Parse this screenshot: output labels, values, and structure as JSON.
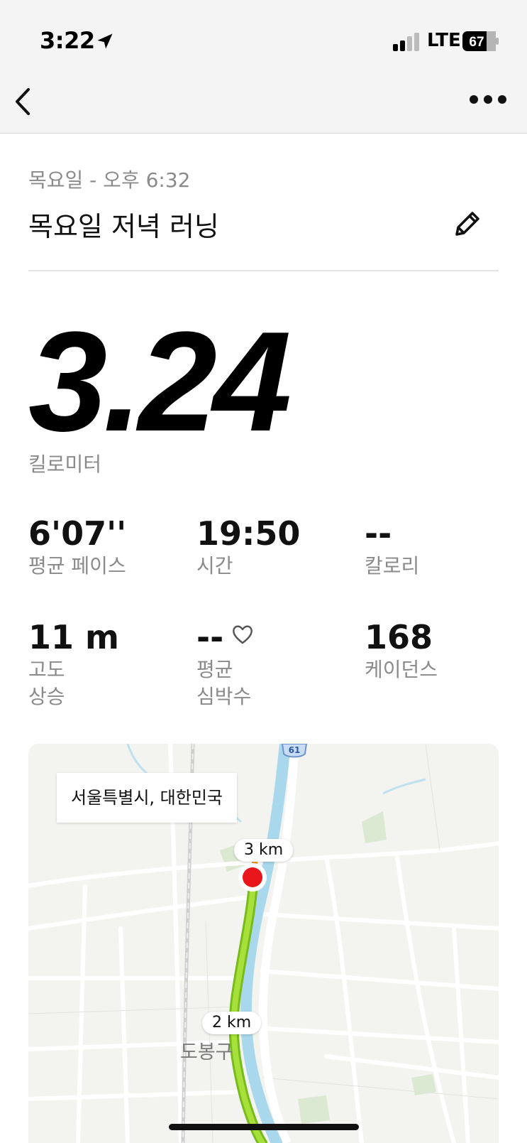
{
  "status_bar": {
    "time": "3:22",
    "network": "LTE",
    "battery": "67"
  },
  "nav": {
    "back_icon": "chevron-left-icon",
    "more_icon": "ellipsis-icon"
  },
  "activity": {
    "datetime": "목요일 - 오후 6:32",
    "title": "목요일 저녁 러닝",
    "distance": "3.24",
    "distance_unit": "킬로미터"
  },
  "stats": [
    {
      "value": "6'07''",
      "label": "평균 페이스"
    },
    {
      "value": "19:50",
      "label": "시간"
    },
    {
      "value": "--",
      "label": "칼로리"
    },
    {
      "value": "11 m",
      "label_lines": [
        "고도",
        "상승"
      ]
    },
    {
      "value": "--",
      "label_lines": [
        "평균",
        "심박수"
      ]
    },
    {
      "value": "168",
      "label": "케이던스"
    }
  ],
  "map": {
    "location": "서울특별시, 대한민국",
    "markers": [
      "3 km",
      "2 km"
    ],
    "district": "도봉구",
    "road_label": "61",
    "route_color": "#8fd42a",
    "end_marker_color": "#e8151b"
  }
}
